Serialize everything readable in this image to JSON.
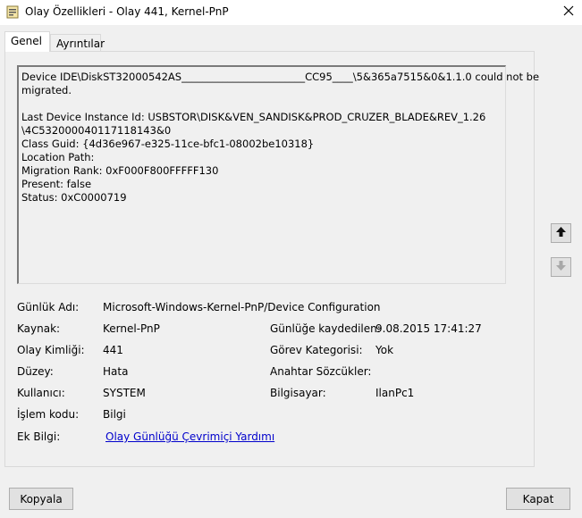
{
  "window": {
    "title": "Olay Özellikleri - Olay 441, Kernel-PnP",
    "icon": "event-properties-icon",
    "close_icon": "close-icon"
  },
  "tabs": [
    {
      "label": "Genel",
      "active": true
    },
    {
      "label": "Ayrıntılar",
      "active": false
    }
  ],
  "description": {
    "lines": [
      "Device IDE\\DiskST32000542AS________________________CC95____\\5&365a7515&0&1.1.0 could not be",
      "migrated.",
      "",
      "Last Device Instance Id: USBSTOR\\DISK&VEN_SANDISK&PROD_CRUZER_BLADE&REV_1.26",
      "\\4C532000040117118143&0",
      "Class Guid: {4d36e967-e325-11ce-bfc1-08002be10318}",
      "Location Path:",
      "Migration Rank: 0xF000F800FFFFF130",
      "Present: false",
      "Status: 0xC0000719"
    ]
  },
  "fields": {
    "log_name": {
      "label": "Günlük Adı:",
      "value": "Microsoft-Windows-Kernel-PnP/Device Configuration"
    },
    "source": {
      "label": "Kaynak:",
      "value": "Kernel-PnP"
    },
    "logged": {
      "label": "Günlüğe kaydedilen:",
      "value": "9.08.2015 17:41:27"
    },
    "event_id": {
      "label": "Olay Kimliği:",
      "value": "441"
    },
    "task_category": {
      "label": "Görev Kategorisi:",
      "value": "Yok"
    },
    "level": {
      "label": "Düzey:",
      "value": "Hata"
    },
    "keywords": {
      "label": "Anahtar Sözcükler:",
      "value": ""
    },
    "user": {
      "label": "Kullanıcı:",
      "value": "SYSTEM"
    },
    "computer": {
      "label": "Bilgisayar:",
      "value": "IlanPc1"
    },
    "opcode": {
      "label": "İşlem kodu:",
      "value": "Bilgi"
    },
    "more_info": {
      "label": "Ek Bilgi:",
      "link": "Olay Günlüğü Çevrimiçi Yardımı"
    }
  },
  "nav": {
    "up_icon": "arrow-up-icon",
    "down_icon": "arrow-down-icon",
    "down_enabled": false
  },
  "buttons": {
    "copy": "Kopyala",
    "close": "Kapat"
  }
}
